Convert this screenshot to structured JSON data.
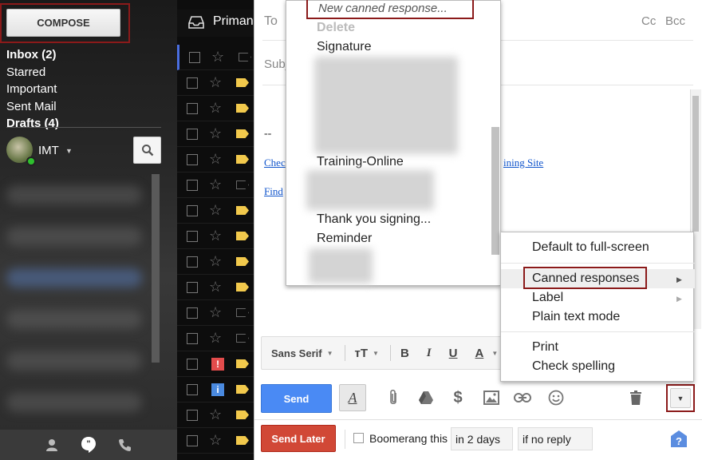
{
  "sidebar": {
    "compose_label": "COMPOSE",
    "nav": [
      {
        "label": "Inbox (2)",
        "bold": true
      },
      {
        "label": "Starred",
        "bold": false
      },
      {
        "label": "Important",
        "bold": false
      },
      {
        "label": "Sent Mail",
        "bold": false
      },
      {
        "label": "Drafts (4)",
        "bold": true
      }
    ],
    "user_name": "IMT"
  },
  "inbox": {
    "tab_label": "Priman",
    "rows": [
      {
        "label": "outline",
        "mark": null
      },
      {
        "label": "yellow",
        "mark": null
      },
      {
        "label": "yellow",
        "mark": null
      },
      {
        "label": "yellow",
        "mark": null
      },
      {
        "label": "yellow",
        "mark": null
      },
      {
        "label": "outline",
        "mark": null
      },
      {
        "label": "yellow",
        "mark": null
      },
      {
        "label": "yellow",
        "mark": null
      },
      {
        "label": "yellow",
        "mark": null
      },
      {
        "label": "yellow",
        "mark": null
      },
      {
        "label": "outline",
        "mark": null
      },
      {
        "label": "outline",
        "mark": null
      },
      {
        "label": "yellow",
        "mark": "important"
      },
      {
        "label": "yellow",
        "mark": "info"
      },
      {
        "label": "yellow",
        "mark": null
      },
      {
        "label": "yellow",
        "mark": null
      },
      {
        "label": "outline",
        "mark": null
      }
    ]
  },
  "compose": {
    "to_label": "To",
    "cc_label": "Cc",
    "bcc_label": "Bcc",
    "subject_placeholder": "Subj",
    "signature_dash": "--",
    "sig_link1": "Chec",
    "sig_link2": "Find",
    "sig_link3": "ining Site",
    "font_label": "Sans Serif",
    "send_label": "Send",
    "send_later_label": "Send Later",
    "boomerang_label": "Boomerang this",
    "boomerang_when": "in 2 days",
    "boomerang_condition": "if no reply"
  },
  "canned_menu": {
    "new_label": "New canned response...",
    "delete_label": "Delete",
    "items": [
      "Signature",
      "Training-Online",
      "Thank you signing...",
      "Reminder"
    ]
  },
  "more_menu": {
    "default_fullscreen": "Default to full-screen",
    "canned_responses": "Canned responses",
    "label": "Label",
    "plain_text": "Plain text mode",
    "print": "Print",
    "check_spelling": "Check spelling"
  },
  "colors": {
    "send_blue": "#4a8af4",
    "send_later_red": "#d14836",
    "highlight_box": "#8b1a1a",
    "label_yellow": "#f2c94c"
  }
}
